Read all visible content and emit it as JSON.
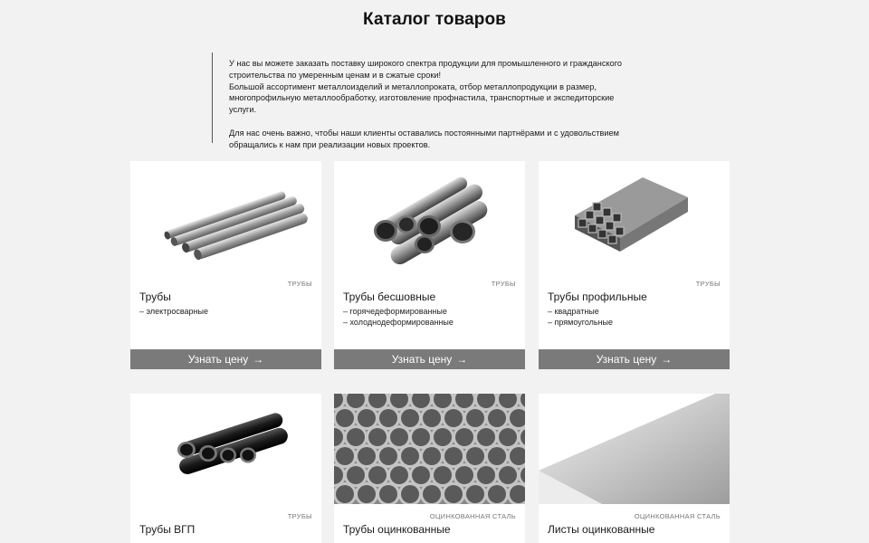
{
  "page": {
    "title": "Каталог товаров",
    "intro": {
      "p1_line1": "У нас вы можете заказать поставку широкого спектра продукции для промышленного и гражданского строительства по умеренным ценам и в сжатые сроки!",
      "p1_line2": "Большой ассортимент металлоизделий и металлопроката, отбор металлопродукции в размер, многопрофильную металлообработку, изготовление профнастила, транспортные и экспедиторские услуги.",
      "p2": "Для нас очень важно, чтобы наши клиенты оставались постоянными партнёрами и с удовольствием обращались к нам при реализации новых проектов."
    }
  },
  "catalog": {
    "button_label": "Узнать цену",
    "button_arrow": "→",
    "cards": [
      {
        "category": "ТРУБЫ",
        "name": "Трубы",
        "items": [
          "электросварные"
        ],
        "image_icon": "pipes-welded-image"
      },
      {
        "category": "ТРУБЫ",
        "name": "Трубы бесшовные",
        "items": [
          "горячедеформированные",
          "холоднодеформированные"
        ],
        "image_icon": "pipes-seamless-image"
      },
      {
        "category": "ТРУБЫ",
        "name": "Трубы профильные",
        "items": [
          "квадратные",
          "прямоугольные"
        ],
        "image_icon": "pipes-profile-image"
      },
      {
        "category": "ТРУБЫ",
        "name": "Трубы ВГП",
        "items": [],
        "image_icon": "pipes-vgp-image"
      },
      {
        "category": "ОЦИНКОВАННАЯ СТАЛЬ",
        "name": "Трубы оцинкованные",
        "items": [],
        "image_icon": "pipes-galvanized-image"
      },
      {
        "category": "ОЦИНКОВАННАЯ СТАЛЬ",
        "name": "Листы оцинкованные",
        "items": [],
        "image_icon": "sheets-galvanized-image"
      }
    ]
  },
  "colors": {
    "background": "#f2f2f2",
    "card": "#ffffff",
    "button": "#7a7a7a"
  }
}
